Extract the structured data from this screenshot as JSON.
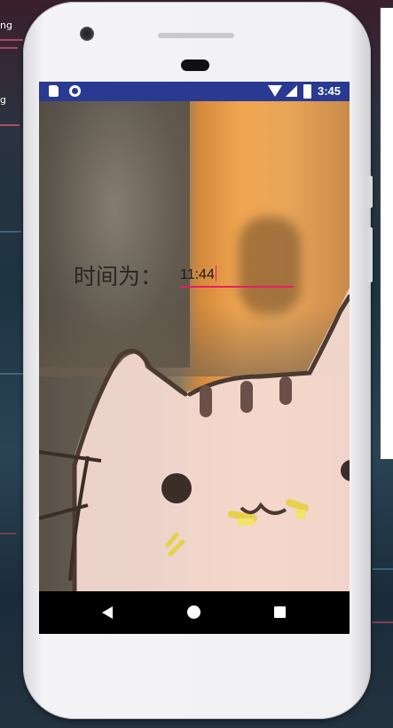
{
  "desktop": {
    "left_texts": [
      "ng",
      "g"
    ]
  },
  "status_bar": {
    "time": "3:45",
    "icons": [
      "sd-card-icon",
      "circle-icon",
      "wifi-icon",
      "signal-icon",
      "battery-icon"
    ]
  },
  "app": {
    "time_label": "时间为：",
    "time_value": "11:44",
    "accent_color": "#e91e63"
  },
  "nav_bar": {
    "icons": [
      "back-icon",
      "home-icon",
      "recent-apps-icon"
    ]
  },
  "colors": {
    "status_bar": "#283a91",
    "nav_bar": "#000000"
  }
}
